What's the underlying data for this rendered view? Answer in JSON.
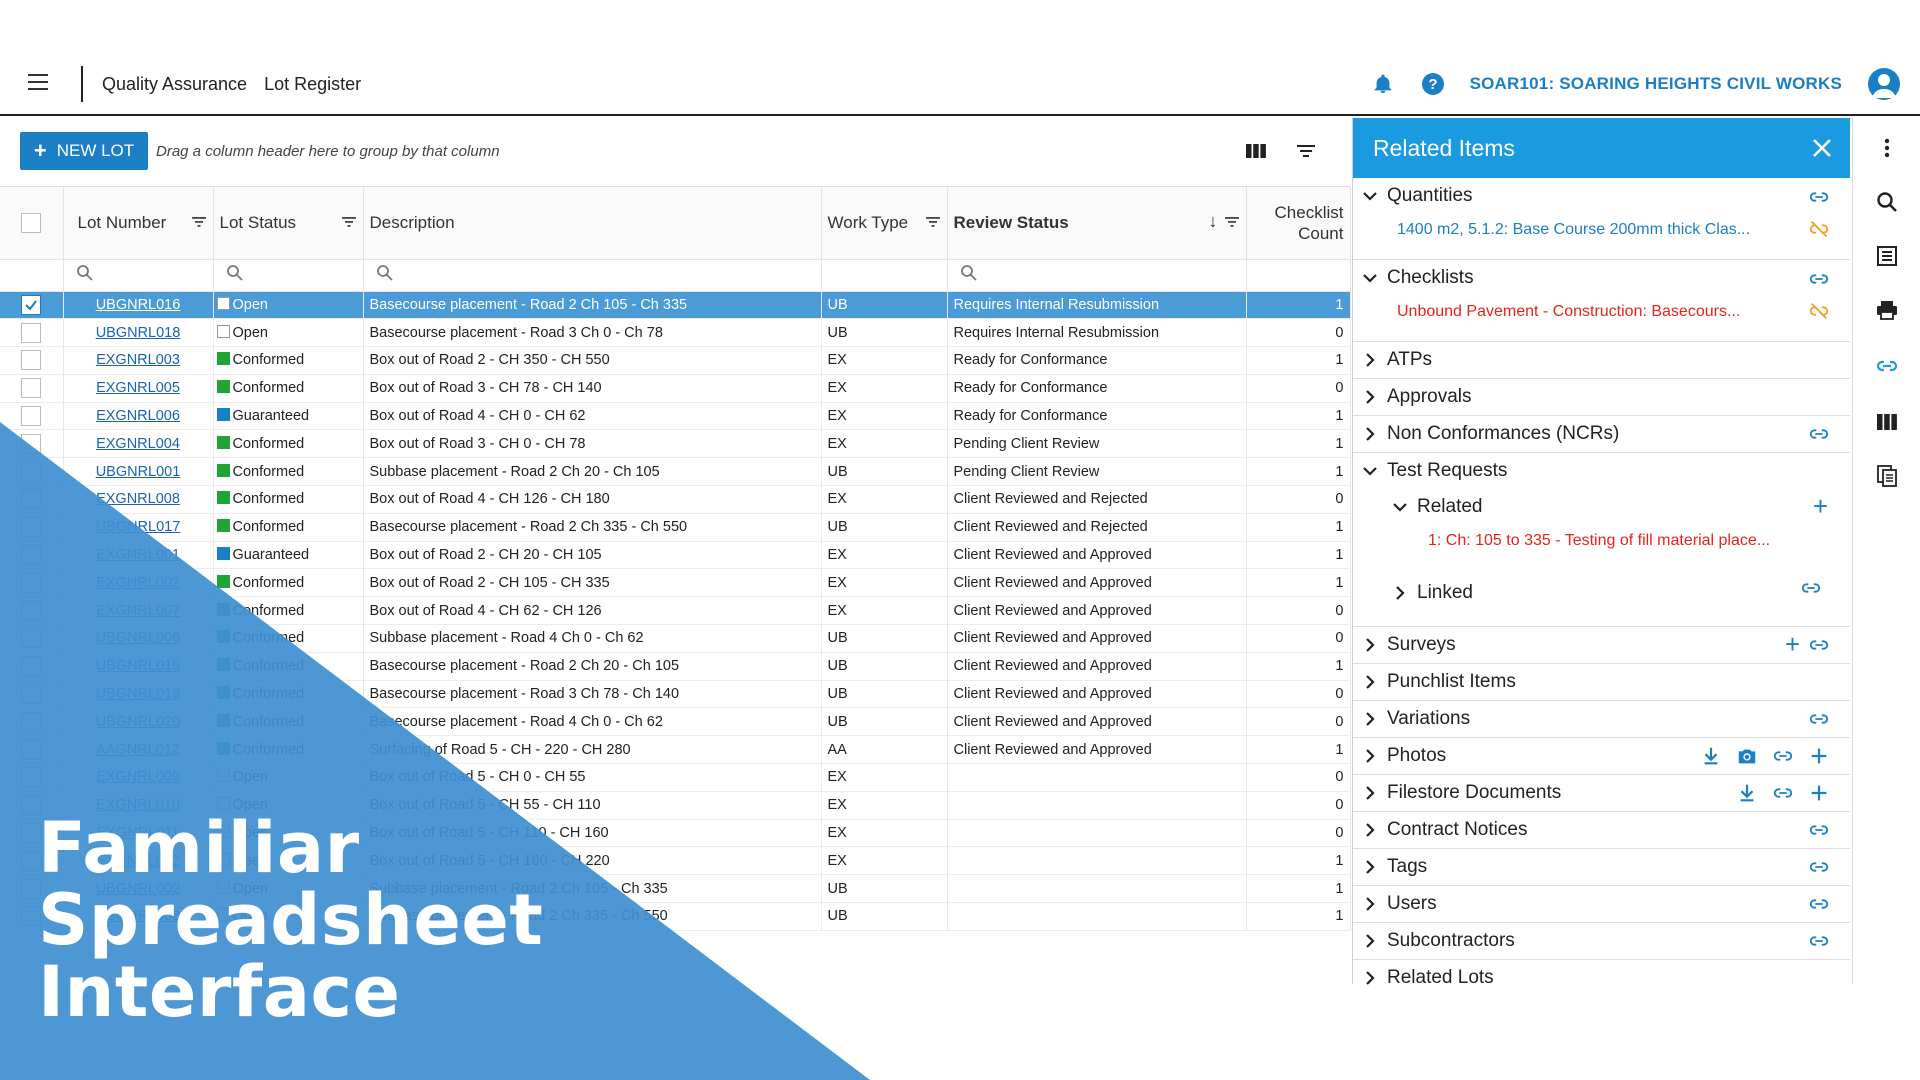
{
  "header": {
    "breadcrumb": [
      "Quality Assurance",
      "Lot Register"
    ],
    "project": "SOAR101: SOARING HEIGHTS CIVIL WORKS"
  },
  "toolbar": {
    "new_lot_label": "NEW LOT",
    "group_hint": "Drag a column header here to group by that column"
  },
  "grid": {
    "columns": [
      "Lot Number",
      "Lot Status",
      "Description",
      "Work Type",
      "Review Status",
      "Checklist",
      "Count"
    ],
    "rows": [
      {
        "lot": "UBGNRL016",
        "status": "Open",
        "status_color": "#ffffff",
        "desc": "Basecourse placement - Road 2 Ch 105 - Ch 335",
        "type": "UB",
        "review": "Requires Internal Resubmission",
        "count": "1",
        "selected": true
      },
      {
        "lot": "UBGNRL018",
        "status": "Open",
        "status_color": "#ffffff",
        "desc": "Basecourse placement - Road 3 Ch 0 - Ch 78",
        "type": "UB",
        "review": "Requires Internal Resubmission",
        "count": "0"
      },
      {
        "lot": "EXGNRL003",
        "status": "Conformed",
        "status_color": "#21a336",
        "desc": "Box out of Road 2 - CH 350 - CH 550",
        "type": "EX",
        "review": "Ready for Conformance",
        "count": "1"
      },
      {
        "lot": "EXGNRL005",
        "status": "Conformed",
        "status_color": "#21a336",
        "desc": "Box out of Road 3 - CH 78 - CH 140",
        "type": "EX",
        "review": "Ready for Conformance",
        "count": "0"
      },
      {
        "lot": "EXGNRL006",
        "status": "Guaranteed",
        "status_color": "#1a7fc4",
        "desc": "Box out of Road 4 - CH 0 - CH 62",
        "type": "EX",
        "review": "Ready for Conformance",
        "count": "1"
      },
      {
        "lot": "EXGNRL004",
        "status": "Conformed",
        "status_color": "#21a336",
        "desc": "Box out of Road 3 - CH 0 - CH 78",
        "type": "EX",
        "review": "Pending Client Review",
        "count": "1"
      },
      {
        "lot": "UBGNRL001",
        "status": "Conformed",
        "status_color": "#21a336",
        "desc": "Subbase placement - Road 2 Ch 20 - Ch 105",
        "type": "UB",
        "review": "Pending Client Review",
        "count": "1"
      },
      {
        "lot": "EXGNRL008",
        "status": "Conformed",
        "status_color": "#21a336",
        "desc": "Box out of Road 4 - CH 126 - CH 180",
        "type": "EX",
        "review": "Client Reviewed and Rejected",
        "count": "0"
      },
      {
        "lot": "UBGNRL017",
        "status": "Conformed",
        "status_color": "#21a336",
        "desc": "Basecourse placement - Road 2 Ch 335 - Ch 550",
        "type": "UB",
        "review": "Client Reviewed and Rejected",
        "count": "1"
      },
      {
        "lot": "EXGNRL001",
        "status": "Guaranteed",
        "status_color": "#1a7fc4",
        "desc": "Box out of Road 2 - CH 20 - CH 105",
        "type": "EX",
        "review": "Client Reviewed and Approved",
        "count": "1"
      },
      {
        "lot": "EXGNRL002",
        "status": "Conformed",
        "status_color": "#21a336",
        "desc": "Box out of Road 2 - CH 105 - CH 335",
        "type": "EX",
        "review": "Client Reviewed and Approved",
        "count": "1"
      },
      {
        "lot": "EXGNRL007",
        "status": "Conformed",
        "status_color": "#21a336",
        "desc": "Box out of Road 4 - CH 62 - CH 126",
        "type": "EX",
        "review": "Client Reviewed and Approved",
        "count": "0"
      },
      {
        "lot": "UBGNRL006",
        "status": "Conformed",
        "status_color": "#21a336",
        "desc": "Subbase placement - Road 4 Ch 0 - Ch 62",
        "type": "UB",
        "review": "Client Reviewed and Approved",
        "count": "0"
      },
      {
        "lot": "UBGNRL015",
        "status": "Conformed",
        "status_color": "#21a336",
        "desc": "Basecourse placement - Road 2 Ch 20 - Ch 105",
        "type": "UB",
        "review": "Client Reviewed and Approved",
        "count": "1"
      },
      {
        "lot": "UBGNRL019",
        "status": "Conformed",
        "status_color": "#21a336",
        "desc": "Basecourse placement - Road 3 Ch 78 - Ch 140",
        "type": "UB",
        "review": "Client Reviewed and Approved",
        "count": "0"
      },
      {
        "lot": "UBGNRL020",
        "status": "Conformed",
        "status_color": "#21a336",
        "desc": "Basecourse placement - Road 4 Ch 0 - Ch 62",
        "type": "UB",
        "review": "Client Reviewed and Approved",
        "count": "0"
      },
      {
        "lot": "AAGNRL012",
        "status": "Conformed",
        "status_color": "#21a336",
        "desc": "Surfacing of Road 5 - CH - 220 - CH 280",
        "type": "AA",
        "review": "Client Reviewed and Approved",
        "count": "1"
      },
      {
        "lot": "EXGNRL009",
        "status": "Open",
        "status_color": "#ffffff",
        "desc": "Box out of Road 5 - CH 0 - CH 55",
        "type": "EX",
        "review": "",
        "count": "0"
      },
      {
        "lot": "EXGNRL010",
        "status": "Open",
        "status_color": "#ffffff",
        "desc": "Box out of Road 5 - CH 55 - CH 110",
        "type": "EX",
        "review": "",
        "count": "0"
      },
      {
        "lot": "EXGNRL011",
        "status": "Open",
        "status_color": "#ffffff",
        "desc": "Box out of Road 5 - CH 110 - CH 160",
        "type": "EX",
        "review": "",
        "count": "0"
      },
      {
        "lot": "EXGNRL012",
        "status": "Open",
        "status_color": "#ffffff",
        "desc": "Box out of Road 5 - CH 160 - CH 220",
        "type": "EX",
        "review": "",
        "count": "1"
      },
      {
        "lot": "UBGNRL002",
        "status": "Open",
        "status_color": "#ffffff",
        "desc": "Subbase placement - Road 2 Ch 105 - Ch 335",
        "type": "UB",
        "review": "",
        "count": "1"
      },
      {
        "lot": "UBGNRL003",
        "status": "Open",
        "status_color": "#ffffff",
        "desc": "Subbase placement - Road 2 Ch 335 - Ch 550",
        "type": "UB",
        "review": "",
        "count": "1"
      }
    ]
  },
  "panel": {
    "title": "Related Items",
    "quantities_label": "Quantities",
    "quantities_item": "1400 m2, 5.1.2: Base Course 200mm thick Clas...",
    "checklists_label": "Checklists",
    "checklists_item": "Unbound Pavement - Construction: Basecours...",
    "atps_label": "ATPs",
    "approvals_label": "Approvals",
    "ncrs_label": "Non Conformances (NCRs)",
    "test_requests_label": "Test Requests",
    "related_label": "Related",
    "related_item": "1: Ch: 105 to 335 - Testing of fill material place...",
    "linked_label": "Linked",
    "surveys_label": "Surveys",
    "punchlist_label": "Punchlist Items",
    "variations_label": "Variations",
    "photos_label": "Photos",
    "filestore_label": "Filestore Documents",
    "contract_notices_label": "Contract Notices",
    "tags_label": "Tags",
    "users_label": "Users",
    "subcontractors_label": "Subcontractors",
    "related_lots_label": "Related Lots"
  },
  "caption": {
    "line1": "Familiar",
    "line2": "Spreadsheet",
    "line3": "Interface"
  },
  "colors": {
    "accent": "#1a7fc4",
    "panel_header": "#1a9ae0",
    "error_text": "#e8221b",
    "overlay_blue": "#3f8fd2"
  }
}
